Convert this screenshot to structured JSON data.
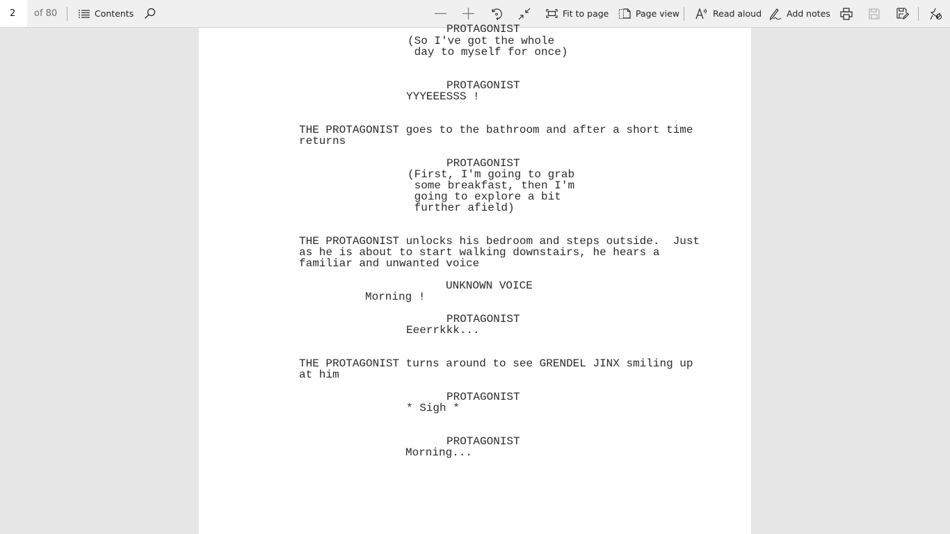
{
  "toolbar": {
    "page_number": "2",
    "page_count": "of 80",
    "contents_label": "Contents",
    "fit_to_page_label": "Fit to page",
    "page_view_label": "Page view",
    "read_aloud_label": "Read aloud",
    "add_notes_label": "Add notes",
    "icons": {
      "contents": "list-icon",
      "search": "search-icon",
      "zoom_out": "minus-icon",
      "zoom_in": "plus-icon",
      "rotate": "rotate-icon",
      "fullscreen": "collapse-icon",
      "fit_to_page": "fit-page-icon",
      "page_view": "page-view-icon",
      "read_aloud": "read-aloud-icon",
      "add_notes": "pen-icon",
      "print": "print-icon",
      "save": "save-icon",
      "save_as": "save-as-icon",
      "unpin": "unpin-icon"
    }
  },
  "document": {
    "lines": [
      {
        "text": "PROTAGONIST",
        "type": "character"
      },
      {
        "text": "(So I've got the whole",
        "type": "parenthetical"
      },
      {
        "text": " day to myself for once)",
        "type": "parenthetical"
      },
      {
        "text": "PROTAGONIST",
        "type": "character"
      },
      {
        "text": "YYYEEESSS !",
        "type": "dialogue"
      },
      {
        "text": "THE PROTAGONIST goes to the bathroom and after a short time",
        "type": "action"
      },
      {
        "text": "returns",
        "type": "action"
      },
      {
        "text": "PROTAGONIST",
        "type": "character"
      },
      {
        "text": "(First, I'm going to grab",
        "type": "parenthetical"
      },
      {
        "text": " some breakfast, then I'm",
        "type": "parenthetical"
      },
      {
        "text": " going to explore a bit",
        "type": "parenthetical"
      },
      {
        "text": " further afield)",
        "type": "parenthetical"
      },
      {
        "text": "THE PROTAGONIST unlocks his bedroom and steps outside.  Just",
        "type": "action"
      },
      {
        "text": "as he is about to start walking downstairs, he hears a",
        "type": "action"
      },
      {
        "text": "familiar and unwanted voice",
        "type": "action"
      },
      {
        "text": "UNKNOWN VOICE",
        "type": "character"
      },
      {
        "text": "Morning !",
        "type": "dialogue"
      },
      {
        "text": "PROTAGONIST",
        "type": "character"
      },
      {
        "text": "Eeerrkkk...",
        "type": "dialogue"
      },
      {
        "text": "THE PROTAGONIST turns around to see GRENDEL JINX smiling up",
        "type": "action"
      },
      {
        "text": "at him",
        "type": "action"
      },
      {
        "text": "PROTAGONIST",
        "type": "character"
      },
      {
        "text": "* Sigh *",
        "type": "dialogue"
      },
      {
        "text": "PROTAGONIST",
        "type": "character"
      },
      {
        "text": "Morning...",
        "type": "dialogue"
      }
    ]
  }
}
